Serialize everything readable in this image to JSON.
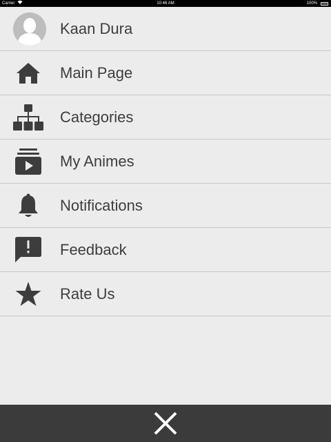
{
  "status_bar": {
    "carrier": "Carrier",
    "time": "10:46 AM",
    "battery_percent": "100%"
  },
  "menu": {
    "user": {
      "name": "Kaan Dura",
      "icon": "avatar"
    },
    "items": [
      {
        "label": "Main Page",
        "icon": "home-icon"
      },
      {
        "label": "Categories",
        "icon": "sitemap-icon"
      },
      {
        "label": "My Animes",
        "icon": "video-library-icon"
      },
      {
        "label": "Notifications",
        "icon": "bell-icon"
      },
      {
        "label": "Feedback",
        "icon": "feedback-icon"
      },
      {
        "label": "Rate Us",
        "icon": "star-icon"
      }
    ]
  },
  "bottom_bar": {
    "close_icon": "close-icon"
  },
  "colors": {
    "background": "#ececec",
    "text": "#3d3d3d",
    "icon": "#3d3d3d",
    "divider": "#c6c6c6",
    "bottom_bar": "#3b3b3b"
  }
}
